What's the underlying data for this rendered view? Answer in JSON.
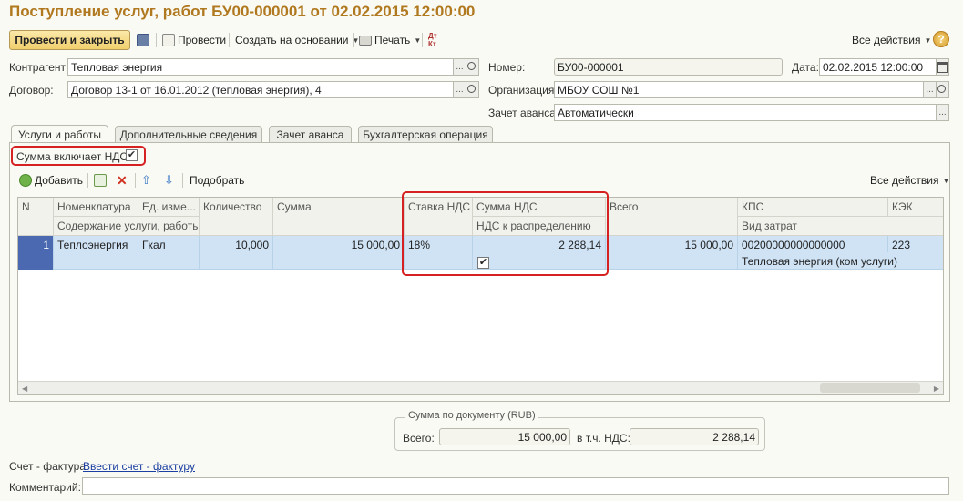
{
  "title": "Поступление услуг, работ БУ00-000001 от 02.02.2015 12:00:00",
  "toolbar": {
    "post_close": "Провести и закрыть",
    "post": "Провести",
    "create_based": "Создать на основании",
    "print": "Печать",
    "all_actions": "Все действия",
    "help": "?"
  },
  "header": {
    "contractor_label": "Контрагент:",
    "contractor_value": "Тепловая энергия",
    "contract_label": "Договор:",
    "contract_value": "Договор 13-1 от 16.01.2012 (тепловая энергия), 4",
    "number_label": "Номер:",
    "number_value": "БУ00-000001",
    "date_label": "Дата:",
    "date_value": "02.02.2015 12:00:00",
    "org_label": "Организация:",
    "org_value": "МБОУ СОШ №1",
    "advance_label": "Зачет аванса:",
    "advance_value": "Автоматически"
  },
  "tabs": [
    {
      "label": "Услуги и работы",
      "active": true
    },
    {
      "label": "Дополнительные сведения",
      "active": false
    },
    {
      "label": "Зачет аванса",
      "active": false
    },
    {
      "label": "Бухгалтерская операция",
      "active": false
    }
  ],
  "vat_included": {
    "label": "Сумма включает НДС:",
    "checked": true,
    "mark": "✔"
  },
  "table_toolbar": {
    "add": "Добавить",
    "pick": "Подобрать",
    "all_actions": "Все действия"
  },
  "table": {
    "headers_top": [
      "N",
      "Номенклатура",
      "Ед. изме...",
      "Количество",
      "Сумма",
      "Ставка НДС",
      "Сумма НДС",
      "Всего",
      "КПС",
      "КЭК"
    ],
    "headers_bottom": [
      "Содержание услуги, работы...",
      "НДС к распределению",
      "Вид затрат"
    ],
    "row": {
      "n": "1",
      "item": "Теплоэнергия",
      "unit": "Гкал",
      "qty": "10,000",
      "sum": "15 000,00",
      "vat_rate": "18%",
      "vat_sum": "2 288,14",
      "total": "15 000,00",
      "kps": "00200000000000000",
      "kek": "223",
      "cost_type": "Тепловая энергия (ком услуги)",
      "vat_distribute_checked": true,
      "vat_distribute_mark": "✔"
    }
  },
  "totals": {
    "legend": "Сумма по документу (RUB)",
    "total_label": "Всего:",
    "total_value": "15 000,00",
    "vat_label": "в т.ч. НДС:",
    "vat_value": "2 288,14"
  },
  "footer": {
    "invoice_label": "Счет - фактура:",
    "invoice_link": "Ввести счет - фактуру",
    "comment_label": "Комментарий:",
    "comment_value": ""
  },
  "colors": {
    "title": "#b0781f",
    "highlight_frame": "#d52121",
    "row_selected": "#cfe3f5"
  }
}
